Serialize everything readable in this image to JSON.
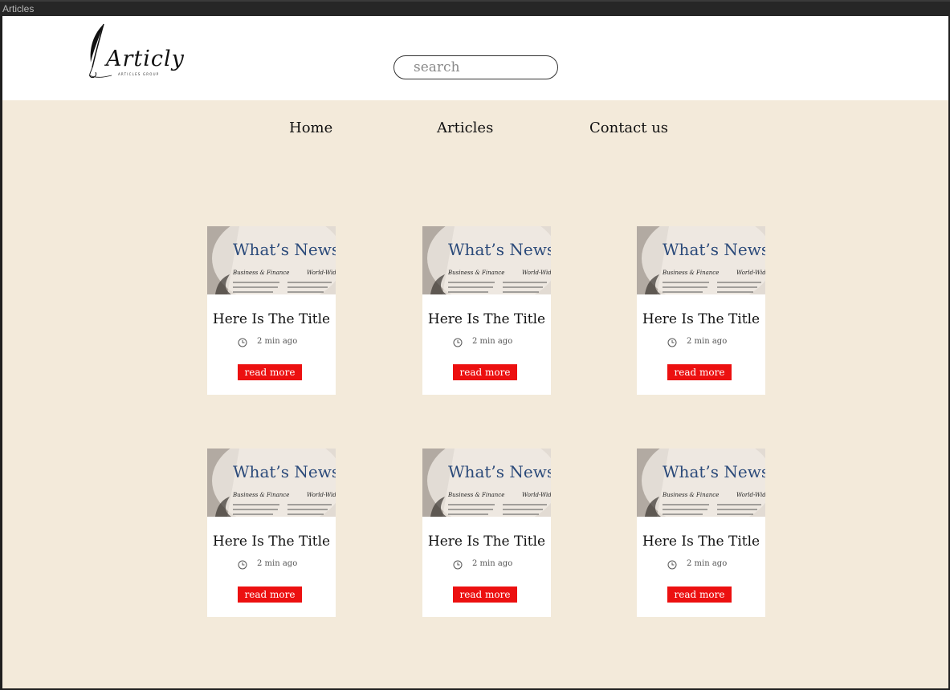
{
  "window": {
    "title": "Articles"
  },
  "header": {
    "logo_text": "Articly",
    "logo_subtext": "ARTICLES GROUP",
    "search_placeholder": "search"
  },
  "nav": {
    "items": [
      {
        "label": "Home"
      },
      {
        "label": "Articles"
      },
      {
        "label": "Contact us"
      }
    ]
  },
  "cards": [
    {
      "image_headline": "What’s News",
      "image_sub1": "Business & Finance",
      "image_sub2": "World-Wide",
      "title": "Here Is The Title",
      "time": "2 min ago",
      "button": "read more"
    },
    {
      "image_headline": "What’s News",
      "image_sub1": "Business & Finance",
      "image_sub2": "World-Wide",
      "title": "Here Is The Title",
      "time": "2 min ago",
      "button": "read more"
    },
    {
      "image_headline": "What’s News",
      "image_sub1": "Business & Finance",
      "image_sub2": "World-Wide",
      "title": "Here Is The Title",
      "time": "2 min ago",
      "button": "read more"
    },
    {
      "image_headline": "What’s News",
      "image_sub1": "Business & Finance",
      "image_sub2": "World-Wide",
      "title": "Here Is The Title",
      "time": "2 min ago",
      "button": "read more"
    },
    {
      "image_headline": "What’s News",
      "image_sub1": "Business & Finance",
      "image_sub2": "World-Wide",
      "title": "Here Is The Title",
      "time": "2 min ago",
      "button": "read more"
    },
    {
      "image_headline": "What’s News",
      "image_sub1": "Business & Finance",
      "image_sub2": "World-Wide",
      "title": "Here Is The Title",
      "time": "2 min ago",
      "button": "read more"
    }
  ],
  "colors": {
    "page_background": "#f3eada",
    "header_background": "#ffffff",
    "button_red": "#ec1010",
    "headline_blue": "#2b4a7a"
  },
  "icons": {
    "logo": "quill-pen-icon",
    "time": "clock-icon",
    "card_image": "newspaper-magnifier-icon"
  }
}
